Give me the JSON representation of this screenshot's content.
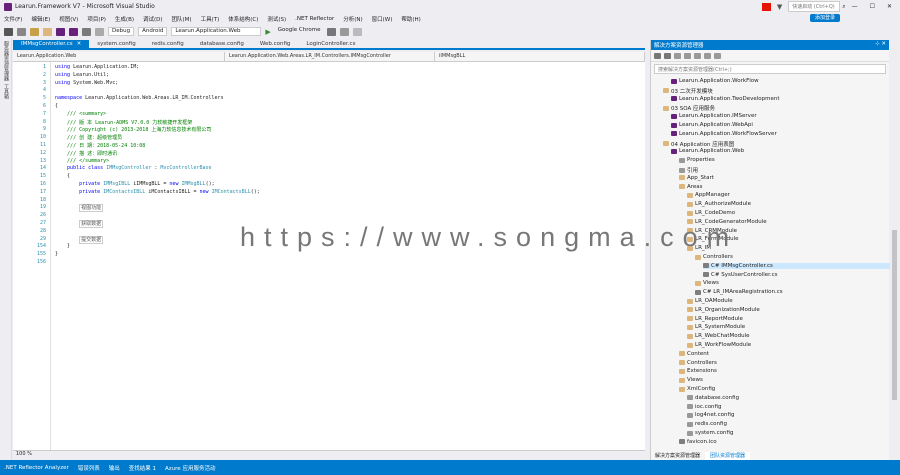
{
  "window": {
    "title": "Learun.Framework V7 - Microsoft Visual Studio",
    "search_placeholder": "快速启动 (Ctrl+Q)",
    "signin": "添加登录"
  },
  "menu": [
    "文件(F)",
    "编辑(E)",
    "视图(V)",
    "项目(P)",
    "生成(B)",
    "调试(D)",
    "团队(M)",
    "工具(T)",
    "体系结构(C)",
    "测试(S)",
    ".NET Reflector",
    "分析(N)",
    "窗口(W)",
    "帮助(H)"
  ],
  "toolbar": {
    "config": "Debug",
    "platform": "Android",
    "startup": "Learun.Application.Web",
    "browser": "Google Chrome"
  },
  "left_strip": [
    "服务器资源管理器",
    "工具箱"
  ],
  "tabs": [
    {
      "label": "IMMsgController.cs",
      "active": true
    },
    {
      "label": "system.config",
      "active": false
    },
    {
      "label": "redis.config",
      "active": false
    },
    {
      "label": "database.config",
      "active": false
    },
    {
      "label": "Web.config",
      "active": false
    },
    {
      "label": "LoginController.cs",
      "active": false
    }
  ],
  "nav": {
    "project": "Learun.Application.Web",
    "class": "Learun.Application.Web.Areas.LR_IM.Controllers.IMMsgController",
    "member": "iIMMsgBLL"
  },
  "code_lines": [
    {
      "n": "1",
      "html": "<span class=\"kw\">using</span> Learun.Application.IM;"
    },
    {
      "n": "2",
      "html": "<span class=\"kw\">using</span> Learun.Util;"
    },
    {
      "n": "3",
      "html": "<span class=\"kw\">using</span> System.Web.Mvc;"
    },
    {
      "n": "4",
      "html": ""
    },
    {
      "n": "5",
      "html": "<span class=\"kw\">namespace</span> Learun.Application.Web.Areas.LR_IM.Controllers"
    },
    {
      "n": "6",
      "html": "{"
    },
    {
      "n": "7",
      "html": "    <span class=\"cm\">/// &lt;summary&gt;</span>"
    },
    {
      "n": "8",
      "html": "    <span class=\"cm\">/// 版 本 Learun-ADMS V7.0.0 力软敏捷开发框架</span>"
    },
    {
      "n": "9",
      "html": "    <span class=\"cm\">/// Copyright (c) 2013-2018 上海力软信息技术有限公司</span>"
    },
    {
      "n": "10",
      "html": "    <span class=\"cm\">/// 创 建：超级管理员</span>"
    },
    {
      "n": "11",
      "html": "    <span class=\"cm\">/// 日 期：2018-05-24 10:08</span>"
    },
    {
      "n": "12",
      "html": "    <span class=\"cm\">/// 描 述：即时通讯</span>"
    },
    {
      "n": "13",
      "html": "    <span class=\"cm\">/// &lt;/summary&gt;</span>"
    },
    {
      "n": "14",
      "html": "    <span class=\"kw\">public class</span> <span class=\"ty\">IMMsgController</span> : <span class=\"ty\">MvcControllerBase</span>"
    },
    {
      "n": "15",
      "html": "    {"
    },
    {
      "n": "16",
      "html": "        <span class=\"kw\">private</span> <span class=\"ty\">IMMsgIBLL</span> iIMMsgBLL = <span class=\"kw\">new</span> <span class=\"ty\">IMMsgBLL</span>();"
    },
    {
      "n": "17",
      "html": "        <span class=\"kw\">private</span> <span class=\"ty\">IMContactsIBLL</span> iMContactsIBLL = <span class=\"kw\">new</span> <span class=\"ty\">IMContactsBLL</span>();"
    },
    {
      "n": "18",
      "html": ""
    },
    {
      "n": "19",
      "html": "        <span class=\"rg\">视图功能</span>"
    },
    {
      "n": "26",
      "html": ""
    },
    {
      "n": "27",
      "html": "        <span class=\"rg\">获取数据</span>"
    },
    {
      "n": "28",
      "html": ""
    },
    {
      "n": "29",
      "html": "        <span class=\"rg\">提交数据</span>"
    },
    {
      "n": "154",
      "html": "    }"
    },
    {
      "n": "155",
      "html": "}"
    },
    {
      "n": "156",
      "html": ""
    }
  ],
  "zoom": "100 %",
  "bottom_bar": [
    ".NET Reflector Analyzer",
    "错误列表",
    "输出",
    "查找结果 1",
    "Azure 应用服务活动"
  ],
  "solution": {
    "header": "解决方案资源管理器",
    "search": "搜索解决方案资源管理器(Ctrl+;)",
    "items": [
      {
        "indent": 2,
        "type": "proj",
        "label": "Learun.Application.WorkFlow"
      },
      {
        "indent": 1,
        "type": "folder",
        "label": "03 二次开发模块"
      },
      {
        "indent": 2,
        "type": "proj",
        "label": "Learun.Application.TwoDevelopment"
      },
      {
        "indent": 1,
        "type": "folder",
        "label": "03 SOA 应用服务"
      },
      {
        "indent": 2,
        "type": "proj",
        "label": "Learun.Application.IMServer"
      },
      {
        "indent": 2,
        "type": "proj",
        "label": "Learun.Application.WebApi"
      },
      {
        "indent": 2,
        "type": "proj",
        "label": "Learun.Application.WorkFlowServer"
      },
      {
        "indent": 1,
        "type": "folder",
        "label": "04 Application 应用表图"
      },
      {
        "indent": 2,
        "type": "proj",
        "label": "Learun.Application.Web"
      },
      {
        "indent": 3,
        "type": "cfg",
        "label": "Properties"
      },
      {
        "indent": 3,
        "type": "cfg",
        "label": "引用"
      },
      {
        "indent": 3,
        "type": "folder",
        "label": "App_Start"
      },
      {
        "indent": 3,
        "type": "folder",
        "label": "Areas"
      },
      {
        "indent": 4,
        "type": "folder",
        "label": "AppManager"
      },
      {
        "indent": 4,
        "type": "folder",
        "label": "LR_AuthorizeModule"
      },
      {
        "indent": 4,
        "type": "folder",
        "label": "LR_CodeDemo"
      },
      {
        "indent": 4,
        "type": "folder",
        "label": "LR_CodeGeneratorModule"
      },
      {
        "indent": 4,
        "type": "folder",
        "label": "LR_CRMModule"
      },
      {
        "indent": 4,
        "type": "folder",
        "label": "LR_FormModule"
      },
      {
        "indent": 4,
        "type": "folder",
        "label": "LR_IM"
      },
      {
        "indent": 5,
        "type": "folder",
        "label": "Controllers"
      },
      {
        "indent": 6,
        "type": "file",
        "label": "C# IMMsgController.cs"
      },
      {
        "indent": 6,
        "type": "file",
        "label": "C# SysUserController.cs"
      },
      {
        "indent": 5,
        "type": "folder",
        "label": "Views"
      },
      {
        "indent": 5,
        "type": "file",
        "label": "C# LR_IMAreaRegistration.cs"
      },
      {
        "indent": 4,
        "type": "folder",
        "label": "LR_OAModule"
      },
      {
        "indent": 4,
        "type": "folder",
        "label": "LR_OrganizationModule"
      },
      {
        "indent": 4,
        "type": "folder",
        "label": "LR_ReportModule"
      },
      {
        "indent": 4,
        "type": "folder",
        "label": "LR_SystemModule"
      },
      {
        "indent": 4,
        "type": "folder",
        "label": "LR_WebChatModule"
      },
      {
        "indent": 4,
        "type": "folder",
        "label": "LR_WorkFlowModule"
      },
      {
        "indent": 3,
        "type": "folder",
        "label": "Content"
      },
      {
        "indent": 3,
        "type": "folder",
        "label": "Controllers"
      },
      {
        "indent": 3,
        "type": "folder",
        "label": "Extensions"
      },
      {
        "indent": 3,
        "type": "folder",
        "label": "Views"
      },
      {
        "indent": 3,
        "type": "folder",
        "label": "XmlConfig"
      },
      {
        "indent": 4,
        "type": "cfg",
        "label": "database.config"
      },
      {
        "indent": 4,
        "type": "cfg",
        "label": "ioc.config"
      },
      {
        "indent": 4,
        "type": "cfg",
        "label": "log4net.config"
      },
      {
        "indent": 4,
        "type": "cfg",
        "label": "redis.config"
      },
      {
        "indent": 4,
        "type": "cfg",
        "label": "system.config"
      },
      {
        "indent": 3,
        "type": "file",
        "label": "favicon.ico"
      }
    ],
    "bottom_tabs": [
      "解决方案资源管理器",
      "团队资源管理器"
    ]
  },
  "watermark": "https://www.songma.com",
  "colors": {
    "accent": "#007acc"
  }
}
